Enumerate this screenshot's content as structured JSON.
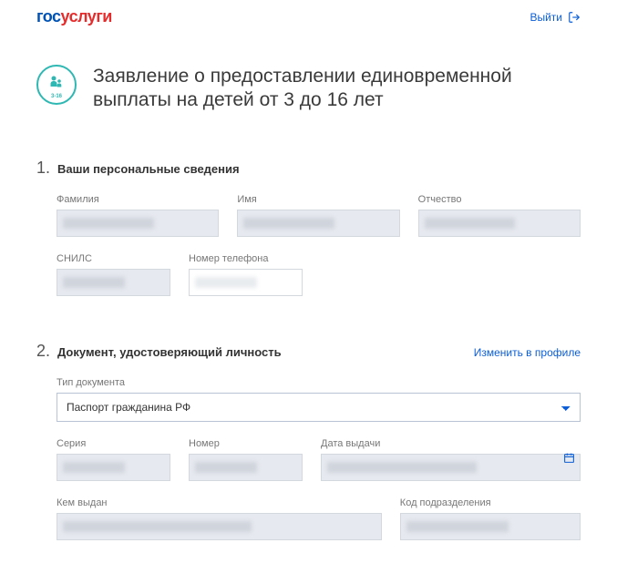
{
  "logo": {
    "part1": "гос",
    "part2": "услуги"
  },
  "logout_label": "Выйти",
  "title_icon_age": "3-16",
  "page_title": "Заявление о предоставлении единовременной выплаты на детей от 3 до 16 лет",
  "sections": {
    "s1": {
      "num": "1.",
      "title": "Ваши персональные сведения",
      "fields": {
        "lastname": "Фамилия",
        "firstname": "Имя",
        "patronymic": "Отчество",
        "snils": "СНИЛС",
        "phone": "Номер телефона"
      }
    },
    "s2": {
      "num": "2.",
      "title": "Документ, удостоверяющий личность",
      "link": "Изменить в профиле",
      "fields": {
        "doc_type": "Тип документа",
        "doc_type_value": "Паспорт гражданина РФ",
        "series": "Серия",
        "number": "Номер",
        "issue_date": "Дата выдачи",
        "issued_by": "Кем выдан",
        "dept_code": "Код подразделения"
      }
    }
  }
}
